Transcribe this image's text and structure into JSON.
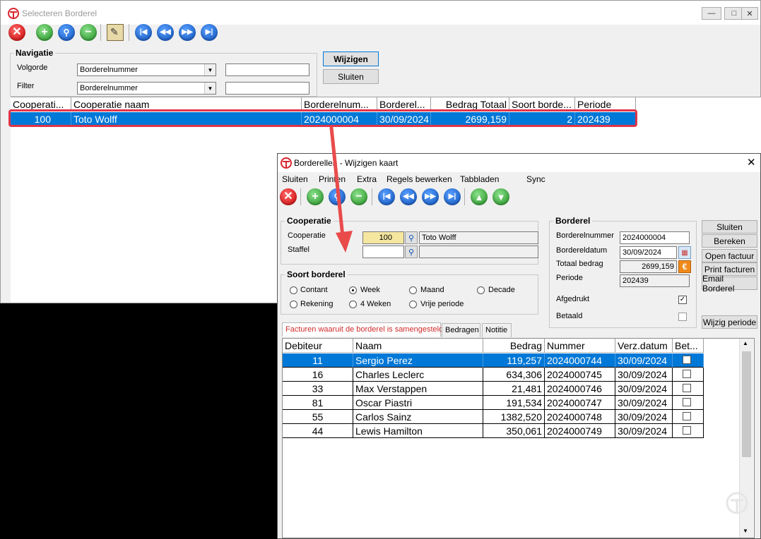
{
  "back_window": {
    "title": "Selecteren Borderel",
    "nav_legend": "Navigatie",
    "volgorde_label": "Volgorde",
    "volgorde_value": "Borderelnummer",
    "filter_label": "Filter",
    "filter_value": "Borderelnummer",
    "wijzigen_label": "Wijzigen",
    "sluiten_label": "Sluiten",
    "columns": [
      "Cooperati...",
      "Cooperatie naam",
      "Borderelnum...",
      "Borderel...",
      "Bedrag Totaal",
      "Soort borde...",
      "Periode"
    ],
    "row": {
      "cooperatie": "100",
      "naam": "Toto Wolff",
      "borderelnummer": "2024000004",
      "borderel": "30/09/2024",
      "bedrag": "2699,159",
      "soort": "2",
      "periode": "202439"
    }
  },
  "front_window": {
    "title": "Borderellen - Wijzigen kaart",
    "menu": [
      "Sluiten",
      "Printen",
      "Extra",
      "Regels bewerken",
      "Tabbladen",
      "Sync"
    ],
    "cooperatie_legend": "Cooperatie",
    "cooperatie_label": "Cooperatie",
    "cooperatie_value": "100",
    "cooperatie_name": "Toto Wolff",
    "staffel_label": "Staffel",
    "staffel_value": "",
    "soort_legend": "Soort borderel",
    "radios": [
      {
        "label": "Contant",
        "checked": false
      },
      {
        "label": "Week",
        "checked": true
      },
      {
        "label": "Maand",
        "checked": false
      },
      {
        "label": "Decade",
        "checked": false
      },
      {
        "label": "Rekening",
        "checked": false
      },
      {
        "label": "4 Weken",
        "checked": false
      },
      {
        "label": "Vrije periode",
        "checked": false
      }
    ],
    "borderel_legend": "Borderel",
    "borderelnummer_label": "Borderelnummer",
    "borderelnummer_value": "2024000004",
    "bordereldatum_label": "Bordereldatum",
    "bordereldatum_value": "30/09/2024",
    "totaal_label": "Totaal bedrag",
    "totaal_value": "2699,159",
    "periode_label": "Periode",
    "periode_value": "202439",
    "afgedrukt_label": "Afgedrukt",
    "afgedrukt_checked": true,
    "betaald_label": "Betaald",
    "betaald_checked": false,
    "side_buttons": [
      "Sluiten",
      "Bereken",
      "Open factuur",
      "Print facturen",
      "Email Borderel"
    ],
    "wijzig_periode": "Wijzig periode",
    "tabs": [
      "Facturen waaruit de borderel is samengesteld",
      "Bedragen",
      "Notitie"
    ],
    "columns": [
      "Debiteur",
      "Naam",
      "Bedrag",
      "Nummer",
      "Verz.datum",
      "Bet..."
    ],
    "rows": [
      {
        "debiteur": "11",
        "naam": "Sergio Perez",
        "bedrag": "119,257",
        "nummer": "2024000744",
        "datum": "30/09/2024"
      },
      {
        "debiteur": "16",
        "naam": "Charles Leclerc",
        "bedrag": "634,306",
        "nummer": "2024000745",
        "datum": "30/09/2024"
      },
      {
        "debiteur": "33",
        "naam": "Max Verstappen",
        "bedrag": "21,481",
        "nummer": "2024000746",
        "datum": "30/09/2024"
      },
      {
        "debiteur": "81",
        "naam": "Oscar Piastri",
        "bedrag": "191,534",
        "nummer": "2024000747",
        "datum": "30/09/2024"
      },
      {
        "debiteur": "55",
        "naam": "Carlos Sainz",
        "bedrag": "1382,520",
        "nummer": "2024000748",
        "datum": "30/09/2024"
      },
      {
        "debiteur": "44",
        "naam": "Lewis Hamilton",
        "bedrag": "350,061",
        "nummer": "2024000749",
        "datum": "30/09/2024"
      }
    ]
  },
  "colors": {
    "selection": "#0078d7",
    "highlight_border": "#e0354a",
    "arrow": "#e94b4b",
    "input_yellow": "#f5e6a0"
  }
}
